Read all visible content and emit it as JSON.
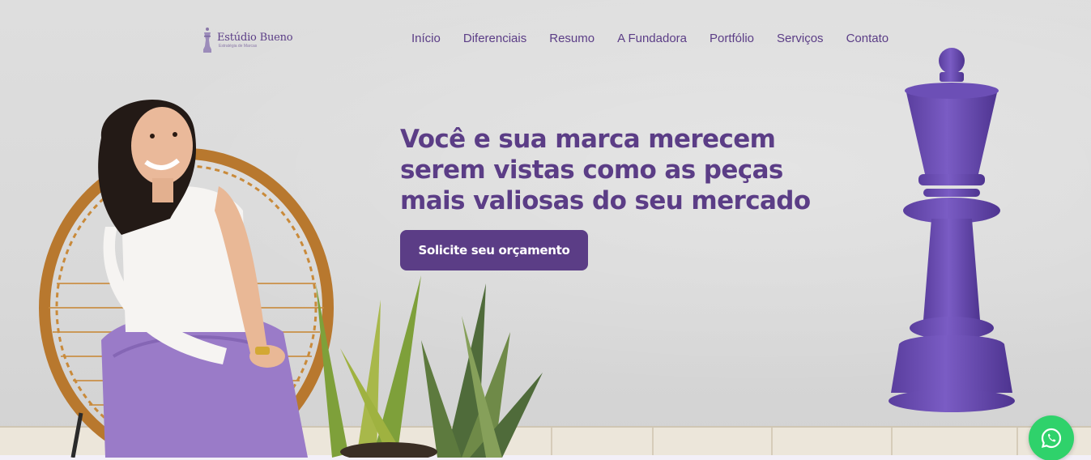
{
  "brand": {
    "name": "Estúdio Bueno",
    "tagline": "Estratégia de Marcas"
  },
  "nav": {
    "items": [
      {
        "label": "Início"
      },
      {
        "label": "Diferenciais"
      },
      {
        "label": "Resumo"
      },
      {
        "label": "A Fundadora"
      },
      {
        "label": "Portfólio"
      },
      {
        "label": "Serviços"
      },
      {
        "label": "Contato"
      }
    ]
  },
  "hero": {
    "headline": "Você e sua marca merecem serem vistas como as peças mais valiosas do seu mercado",
    "cta_label": "Solicite seu orçamento"
  },
  "icons": {
    "whatsapp": "whatsapp-icon",
    "logo": "chess-queen-logo-icon"
  },
  "colors": {
    "brand_purple": "#5b3d86",
    "queen_purple": "#6a4bb0",
    "whatsapp_green": "#2fd26b"
  }
}
